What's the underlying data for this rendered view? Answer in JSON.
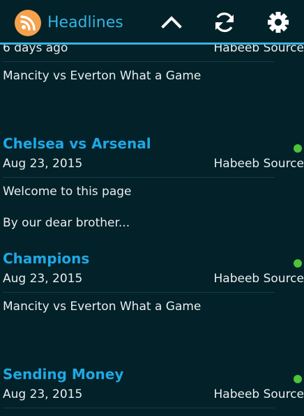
{
  "action_bar": {
    "title": "Headlines",
    "icons": [
      "rss-icon",
      "chevron-up-icon",
      "refresh-icon",
      "settings-icon"
    ]
  },
  "colors": {
    "background": "#022128",
    "accent": "#33b5e5",
    "headline": "#1fa8e4",
    "unread_dot": "#4fc33a",
    "logo": "#f5a24d"
  },
  "articles": [
    {
      "title": "",
      "date": "6 days ago",
      "source": "Habeeb Source",
      "body": [
        "Mancity vs Everton What a Game"
      ]
    },
    {
      "title": "Chelsea vs Arsenal",
      "date": "Aug 23, 2015",
      "source": "Habeeb Source",
      "body": [
        "Welcome to this page",
        "By our dear brother..."
      ]
    },
    {
      "title": "Champions",
      "date": "Aug 23, 2015",
      "source": "Habeeb Source",
      "body": [
        "Mancity vs Everton What a Game"
      ]
    },
    {
      "title": "Sending Money",
      "date": "Aug 23, 2015",
      "source": "Habeeb Source",
      "body": []
    }
  ]
}
